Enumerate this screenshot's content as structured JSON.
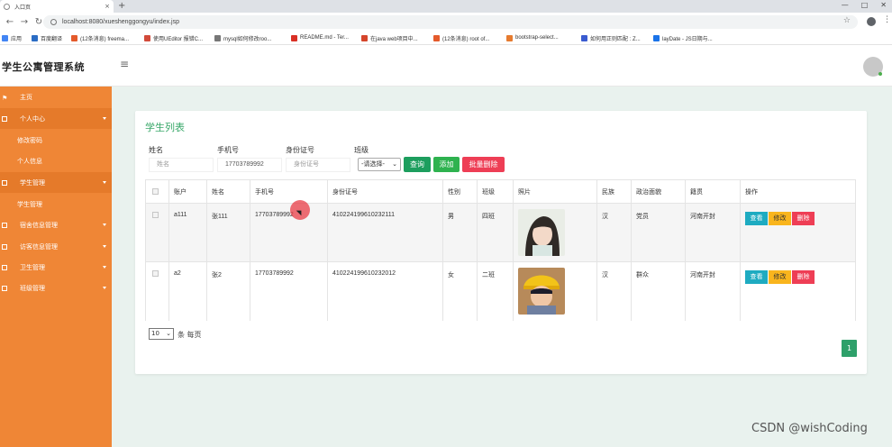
{
  "browser": {
    "tab_title": "入口页",
    "tab_close": "×",
    "new_tab": "+",
    "url": "localhost:8080/xueshenggongyu/index.jsp",
    "bookmarks": [
      "应用",
      "百度翻译",
      "(12条消息) freema...",
      "使用UEditor 报错C...",
      "mysql如何修改roo...",
      "README.md - Ter...",
      "在java web项目中...",
      "(12条消息) root of...",
      "bootstrap-select...",
      "如何用正则匹配 : Z...",
      "layDate - JS日期与..."
    ],
    "bookmark_colors": [
      "#4285f4",
      "#2b6cc4",
      "#e45a2b",
      "#d24a3a",
      "#777777",
      "#d93025",
      "#d5452b",
      "#e45a2b",
      "#e67b2f",
      "#3a5bd0",
      "#1a73e8"
    ]
  },
  "app": {
    "title": "学生公寓管理系统",
    "hamburger": "≡"
  },
  "sidebar": {
    "items": [
      {
        "label": "主页",
        "icon": "flag-icon",
        "has_arrow": false
      },
      {
        "label": "个人中心",
        "icon": "grid-icon",
        "has_arrow": true
      },
      {
        "label": "学生管理",
        "icon": "grid-icon",
        "has_arrow": true
      },
      {
        "label": "宿舍信息管理",
        "icon": "grid-icon",
        "has_arrow": true
      },
      {
        "label": "访客信息管理",
        "icon": "grid-icon",
        "has_arrow": true
      },
      {
        "label": "卫生管理",
        "icon": "grid-icon",
        "has_arrow": true
      },
      {
        "label": "班级管理",
        "icon": "grid-icon",
        "has_arrow": true
      }
    ],
    "subitems": {
      "personal": [
        "修改密码",
        "个人信息"
      ],
      "student": [
        "学生管理"
      ]
    }
  },
  "list": {
    "title": "学生列表",
    "filters": {
      "name_label": "姓名",
      "name_placeholder": "姓名",
      "phone_label": "手机号",
      "phone_value": "17703789992",
      "idcard_label": "身份证号",
      "idcard_placeholder": "身份证号",
      "class_label": "班级",
      "class_selected": "-请选择-"
    },
    "buttons": {
      "query": "查询",
      "add": "添加",
      "batch_delete": "批量删除"
    },
    "columns": [
      "账户",
      "姓名",
      "手机号",
      "身份证号",
      "性别",
      "班级",
      "照片",
      "民族",
      "政治面貌",
      "籍贯",
      "操作"
    ],
    "rows": [
      {
        "account": "a111",
        "name": "张111",
        "phone": "17703789992",
        "idcard": "410224199610232111",
        "gender": "男",
        "class": "四班",
        "ethnicity": "汉",
        "politics": "党员",
        "hometown": "河南开封"
      },
      {
        "account": "a2",
        "name": "张2",
        "phone": "17703789992",
        "idcard": "410224199610232012",
        "gender": "女",
        "class": "二班",
        "ethnicity": "汉",
        "politics": "群众",
        "hometown": "河南开封"
      }
    ],
    "row_actions": {
      "view": "查看",
      "edit": "修改",
      "delete": "删除"
    },
    "page_size": "10",
    "page_size_suffix": "条 每页",
    "current_page": "1"
  },
  "watermark": "CSDN @wishCoding"
}
